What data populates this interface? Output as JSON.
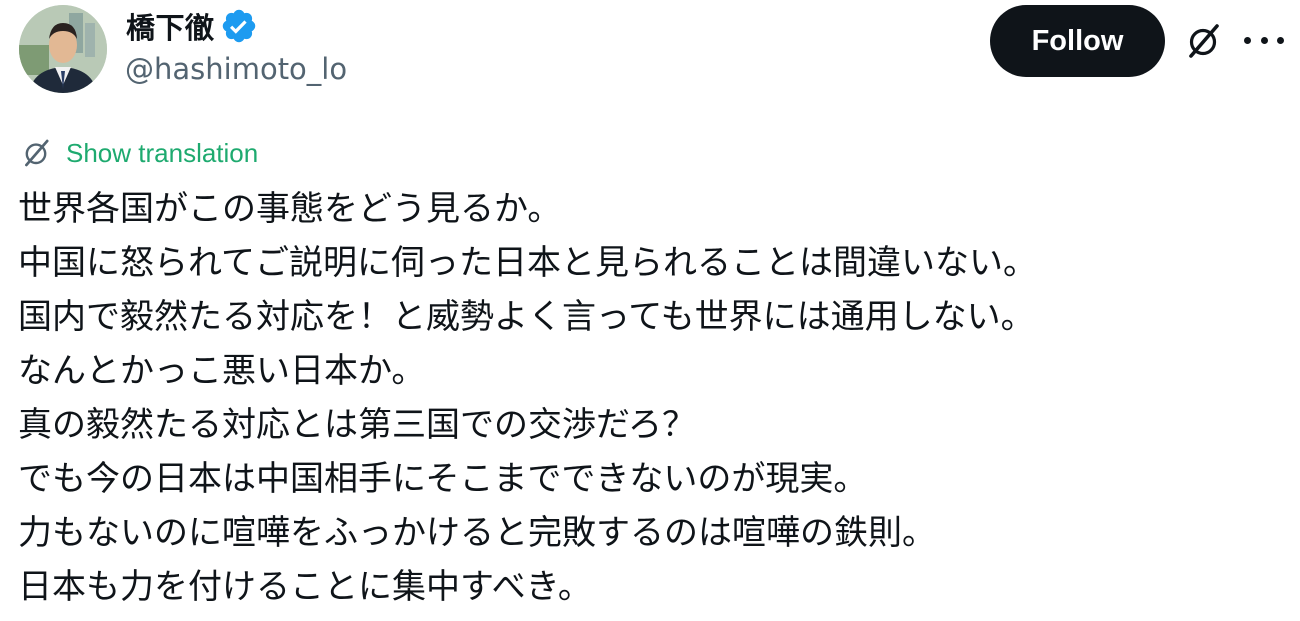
{
  "author": {
    "name": "橋下徹",
    "handle": "@hashimoto_lo",
    "verified": true,
    "verified_color": "#1d9bf0"
  },
  "actions": {
    "follow_label": "Follow",
    "grok_icon": "grok-icon",
    "more_icon": "more-horizontal-icon"
  },
  "translation": {
    "label": "Show translation",
    "color": "#1eaa6f"
  },
  "tweet": {
    "lines": [
      "世界各国がこの事態をどう見るか。",
      "中国に怒られてご説明に伺った日本と見られることは間違いない。",
      "国内で毅然たる対応を！と威勢よく言っても世界には通用しない。",
      "なんとかっこ悪い日本か。",
      "真の毅然たる対応とは第三国での交渉だろ？",
      "でも今の日本は中国相手にそこまでできないのが現実。",
      "力もないのに喧嘩をふっかけると完敗するのは喧嘩の鉄則。",
      "日本も力を付けることに集中すべき。"
    ]
  }
}
